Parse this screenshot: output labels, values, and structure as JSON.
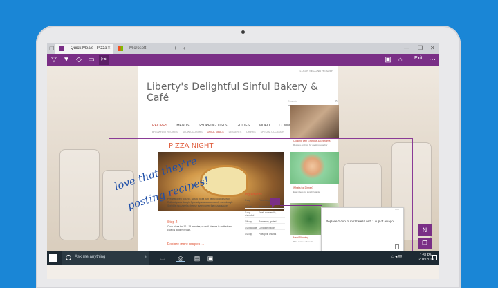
{
  "browser": {
    "tabs": [
      {
        "label": "Quick Meals | Pizza Night",
        "active": true
      },
      {
        "label": "Microsoft",
        "active": false
      }
    ],
    "new_tab": "+",
    "back": "‹",
    "window_controls": {
      "minimize": "—",
      "restore": "❐",
      "close": "✕"
    }
  },
  "pen_toolbar": {
    "tools": [
      "pen-icon",
      "highlighter-icon",
      "eraser-icon",
      "add-note-icon",
      "clip-icon"
    ],
    "right_icons": [
      "save-icon",
      "share-icon"
    ],
    "exit_label": "Exit",
    "more": "···",
    "accent": "#7a2f86"
  },
  "site": {
    "top_links": "LOGIN    SECOND HEADER",
    "title": "Liberty's Delightful Sinful Bakery & Café",
    "search_placeholder": "Search",
    "nav": [
      "RECIPES",
      "MENUS",
      "SHOPPING LISTS",
      "GUIDES",
      "VIDEO",
      "COMMUNITY"
    ],
    "subnav": [
      "BREAKFAST RECIPES",
      "SLOW COOKERS",
      "QUICK MEALS",
      "DESSERTS",
      "DRINKS",
      "SPECIAL OCCASION"
    ],
    "section_title": "PIZZA NIGHT",
    "step1_title": "Step 1",
    "step1_text": "Preheat oven to 425°. Spray pizza pan with cooking spray. Roll out pizza dough. Spread pizza sauce evenly over dough. Sprinkle mozzarella cheese evenly over the pizza sauce.",
    "step2_title": "Step 2",
    "step2_text": "Cook pizza for 10 - 15 minutes, or until cheese is melted and crust is golden brown.",
    "explore": "Explore more recipes →",
    "ingredients_title": "Ingredients",
    "ingredients": [
      {
        "qty": "1 cup",
        "item": "Pizza dough"
      },
      {
        "qty": "1/2 cup",
        "item": "Pizza sauce"
      },
      {
        "qty": "1 cup",
        "item": "Fresh mozzarella, shredded"
      },
      {
        "qty": "1/4 cup",
        "item": "Parmesan, grated"
      },
      {
        "qty": "1/2 package",
        "item": "Canadian bacon"
      },
      {
        "qty": "1/2 cup",
        "item": "Pineapple chunks"
      }
    ],
    "side_items": [
      {
        "caption": "Cooking with Grandpa & Grandma",
        "desc": "Recipes and tips for cooking together"
      },
      {
        "caption": "What's for Dinner?",
        "desc": "Easy ideas for tonight's table"
      },
      {
        "caption": "Meal Planning",
        "desc": "Plan a week of meals"
      }
    ]
  },
  "ink": {
    "line1": "love that they're",
    "line2": "posting recipes!"
  },
  "note": {
    "text": "Replace 1 cup of mozzarella with 1 cup of asiago",
    "menu": "···"
  },
  "share_tiles": [
    "onenote-icon",
    "reading-list-icon"
  ],
  "taskbar": {
    "search_placeholder": "Ask me anything",
    "time": "1:31 PM",
    "date": "2/16/2015"
  }
}
